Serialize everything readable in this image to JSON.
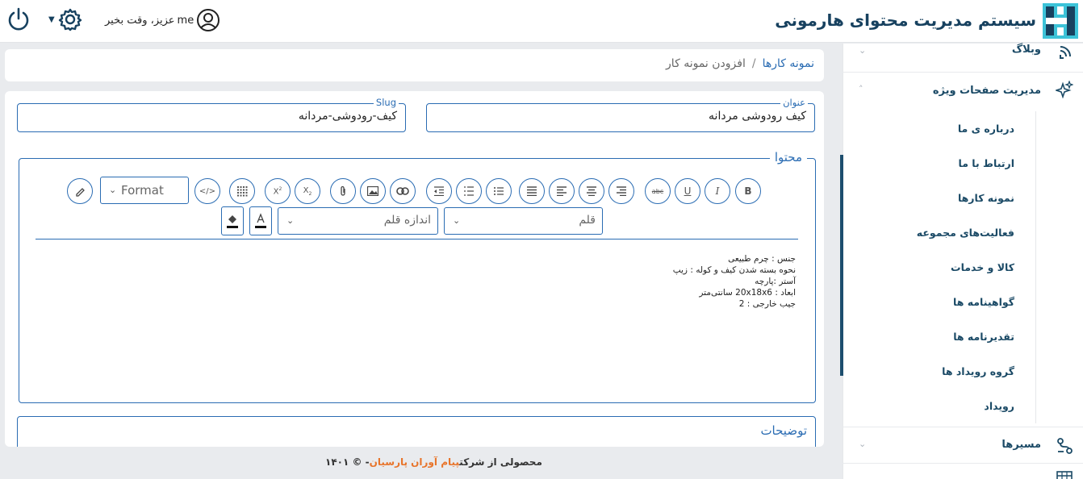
{
  "header": {
    "app_title": "سیستم مدیریت محتوای هارمونی",
    "greeting": "عزیز، وقت بخیر",
    "username": "me"
  },
  "sidebar": {
    "items": [
      {
        "label": "وبلاگ",
        "icon": "blog-icon"
      },
      {
        "label": "مدیریت صفحات ویژه",
        "icon": "sparkles-icon"
      },
      {
        "label": "مسیرها",
        "icon": "route-icon"
      }
    ],
    "sub_items": [
      "درباره ی ما",
      "ارتباط با ما",
      "نمونه کارها",
      "فعالیت‌های مجموعه",
      "کالا و خدمات",
      "گواهینامه ها",
      "تقدیرنامه ها",
      "گروه رویداد ها",
      "رویداد"
    ]
  },
  "breadcrumb": {
    "parent": "نمونه کارها",
    "separator": "/",
    "current": "افزودن نمونه کار"
  },
  "form": {
    "title_label": "عنوان",
    "title_value": "کیف رودوشی مردانه",
    "slug_label": "Slug",
    "slug_value": "کیف-رودوشی-مردانه",
    "content_label": "محتوا",
    "description_label": "توضیحات"
  },
  "editor": {
    "format_select": "Format",
    "font_select": "قلم",
    "size_select": "اندازه قلم",
    "body_lines": [
      "جنس : چرم طبیعی",
      "نحوه بسته شدن کیف و کوله : زیپ",
      "آستر :پارچه",
      "ابعاد : 20x18x6 سانتی‌متر",
      "جیب خارجی : 2"
    ]
  },
  "footer": {
    "prefix": "محصولی از شرکت",
    "company": "پیام آوران پارسیان",
    "suffix": "- © ۱۴۰۱"
  },
  "colors": {
    "primary": "#2a6cb3",
    "brand_dark": "#17415f",
    "accent_orange": "#e8742a",
    "logo_cyan": "#3cc3d8"
  }
}
